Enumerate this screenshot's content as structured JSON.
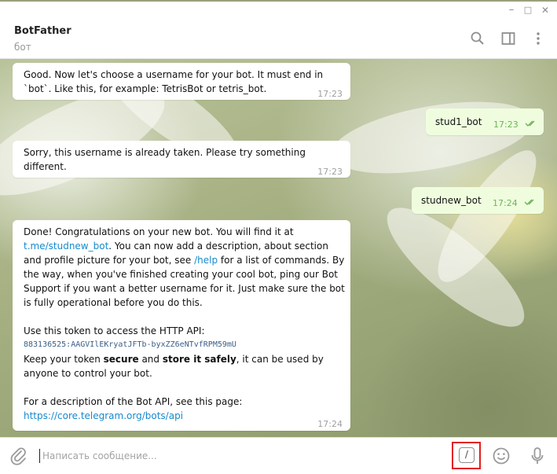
{
  "window": {
    "controls": {
      "minimize": "–",
      "maximize": "□",
      "close": "✕"
    }
  },
  "header": {
    "title": "BotFather",
    "subtitle": "бот"
  },
  "messages": [
    {
      "lines": [
        "Good. Now let's choose a username for your bot. It must end in",
        "`bot`. Like this, for example: TetrisBot or tetris_bot."
      ],
      "time": "17:23"
    },
    {
      "text": "stud1_bot",
      "time": "17:23"
    },
    {
      "lines": [
        "Sorry, this username is already taken. Please try something",
        "different."
      ],
      "time": "17:23"
    },
    {
      "text": "studnew_bot",
      "time": "17:24"
    },
    {
      "line1": "Done! Congratulations on your new bot. You will find it at",
      "link1": "t.me/studnew_bot",
      "line2_after": ". You can now add a description, about section",
      "line3_before": "and profile picture for your bot, see ",
      "link2": "/help",
      "line3_after": " for a list of commands. By",
      "line4": "the way, when you've finished creating your cool bot, ping our Bot",
      "line5": "Support if you want a better username for it. Just make sure the bot",
      "line6": "is fully operational before you do this.",
      "token_label": "Use this token to access the HTTP API:",
      "token": "883136525:AAGVIlEKryatJFTb-byxZZ6eNTvfRPM59mU",
      "keep_before": "Keep your token ",
      "keep_bold1": "secure",
      "keep_mid": " and ",
      "keep_bold2": "store it safely",
      "keep_after": ", it can be used by",
      "keep_line2": "anyone to control your bot.",
      "api_label": "For a description of the Bot API, see this page:",
      "api_link": "https://core.telegram.org/bots/api",
      "time": "17:24"
    }
  ],
  "composer": {
    "placeholder": "Написать сообщение...",
    "command_glyph": "/"
  },
  "colors": {
    "accent": "#168acd",
    "outgoing_bubble": "#effdde",
    "read_check": "#6fb45a",
    "highlight_box": "#e21e1e"
  }
}
